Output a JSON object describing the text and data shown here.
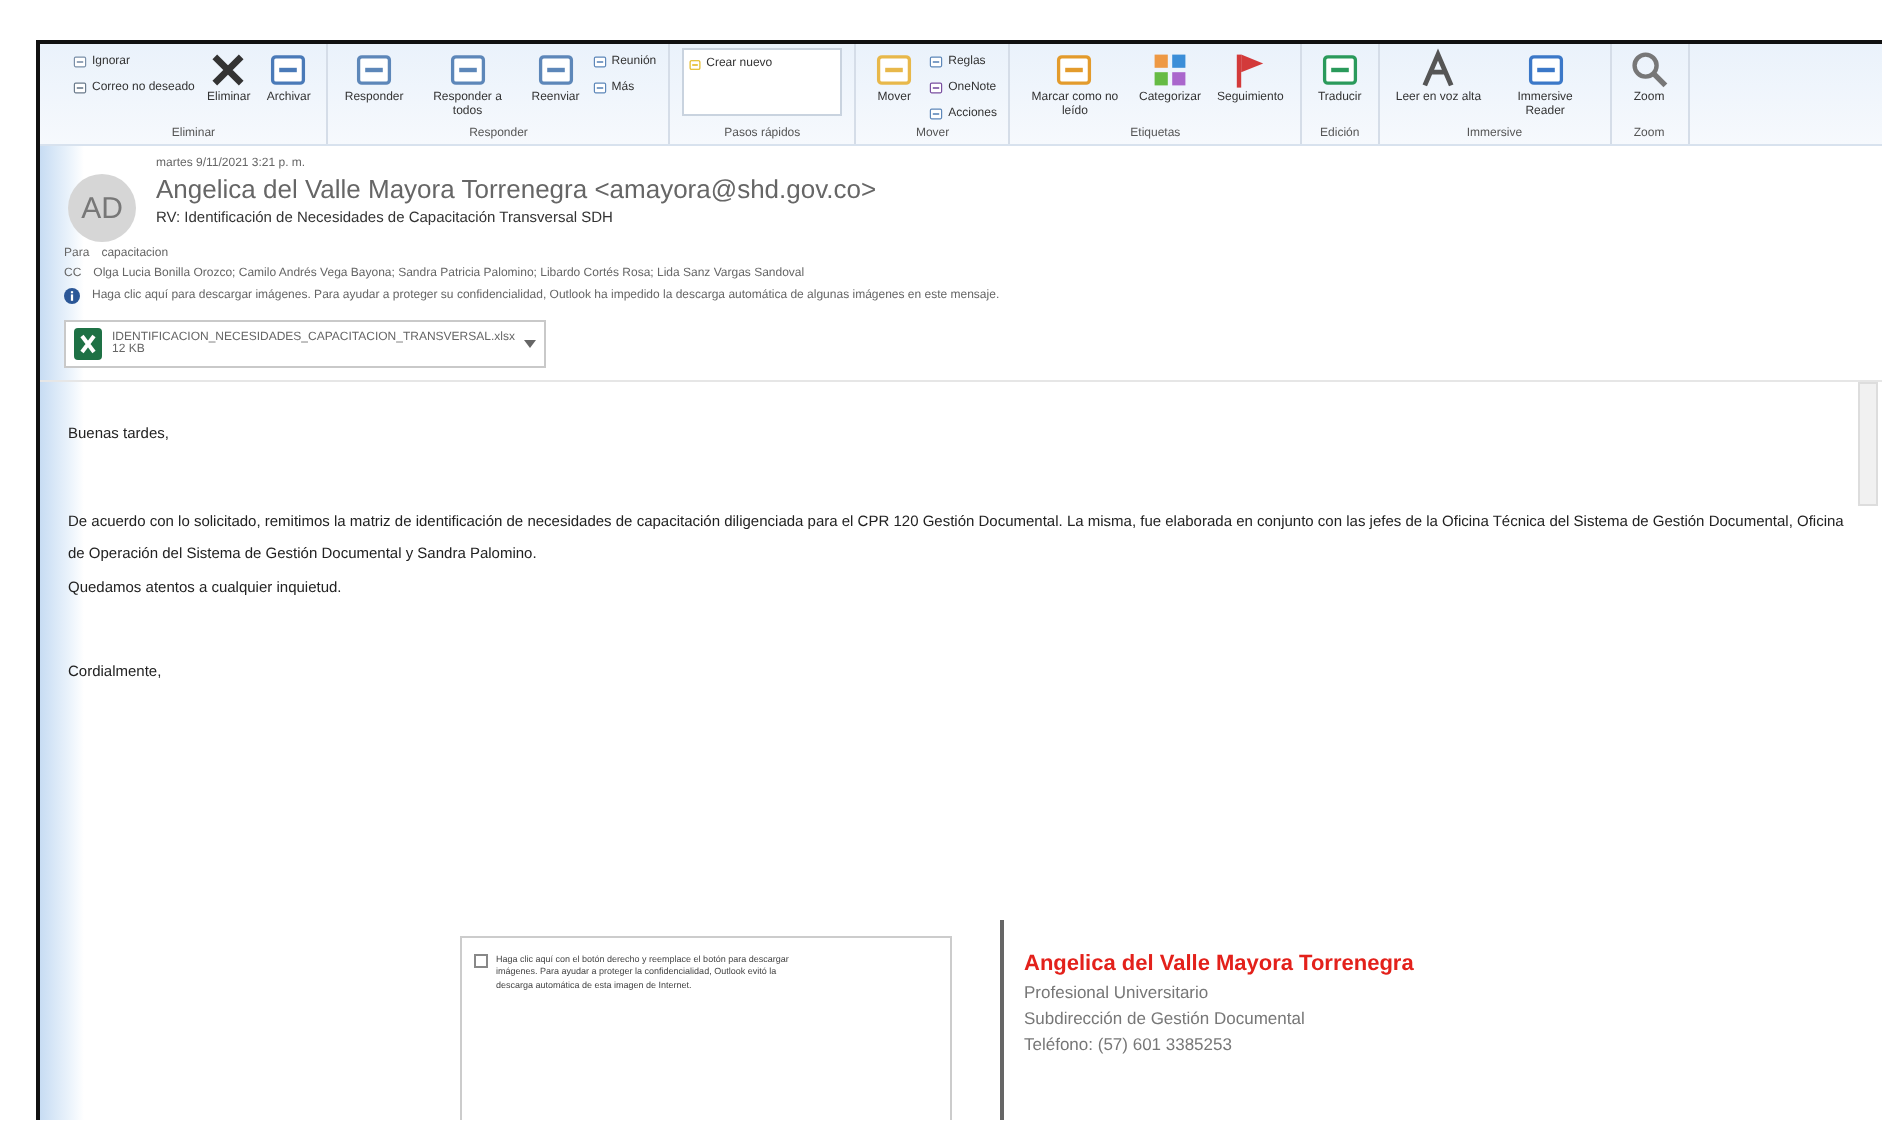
{
  "ribbon": {
    "groups": [
      {
        "label": "Eliminar",
        "buttons": [
          {
            "label": "Ignorar",
            "kind": "small"
          },
          {
            "label": "Correo no deseado",
            "kind": "small"
          },
          {
            "label": "Eliminar",
            "kind": "large"
          },
          {
            "label": "Archivar",
            "kind": "large"
          }
        ]
      },
      {
        "label": "Responder",
        "buttons": [
          {
            "label": "Responder",
            "kind": "large"
          },
          {
            "label": "Responder a todos",
            "kind": "large"
          },
          {
            "label": "Reenviar",
            "kind": "large"
          },
          {
            "label": "Reunión",
            "kind": "small"
          },
          {
            "label": "Más",
            "kind": "small"
          }
        ]
      },
      {
        "label": "Pasos rápidos",
        "buttons": [
          {
            "label": "Crear nuevo",
            "kind": "gallery"
          }
        ]
      },
      {
        "label": "Mover",
        "buttons": [
          {
            "label": "Mover",
            "kind": "large"
          },
          {
            "label": "Reglas",
            "kind": "small"
          },
          {
            "label": "OneNote",
            "kind": "small"
          },
          {
            "label": "Acciones",
            "kind": "small"
          }
        ]
      },
      {
        "label": "Etiquetas",
        "buttons": [
          {
            "label": "Marcar como no leído",
            "kind": "large"
          },
          {
            "label": "Categorizar",
            "kind": "large"
          },
          {
            "label": "Seguimiento",
            "kind": "large"
          }
        ]
      },
      {
        "label": "Edición",
        "buttons": [
          {
            "label": "Traducir",
            "kind": "large"
          }
        ]
      },
      {
        "label": "Immersive",
        "buttons": [
          {
            "label": "Leer en voz alta",
            "kind": "large"
          },
          {
            "label": "Immersive Reader",
            "kind": "large"
          }
        ]
      },
      {
        "label": "Zoom",
        "buttons": [
          {
            "label": "Zoom",
            "kind": "large"
          }
        ]
      }
    ]
  },
  "message": {
    "avatar": "AD",
    "date": "martes 9/11/2021 3:21 p. m.",
    "sender": "Angelica del Valle Mayora Torrenegra <amayora@shd.gov.co>",
    "subject": "RV: Identificación de Necesidades de Capacitación Transversal SDH",
    "to_label": "Para",
    "to": "capacitacion",
    "cc_label": "CC",
    "cc": "Olga Lucia Bonilla Orozco; Camilo Andrés Vega Bayona; Sandra Patricia Palomino; Libardo Cortés Rosa; Lida Sanz Vargas Sandoval",
    "notice": "Haga clic aquí para descargar imágenes. Para ayudar a proteger su confidencialidad, Outlook ha impedido la descarga automática de algunas imágenes en este mensaje.",
    "attachment": {
      "name": "IDENTIFICACION_NECESIDADES_CAPACITACION_TRANSVERSAL.xlsx",
      "size": "12 KB"
    }
  },
  "body": {
    "paragraphs": [
      "Buenas tardes,",
      "De acuerdo con lo solicitado, remitimos la matriz de identificación de necesidades de capacitación diligenciada para el CPR 120 Gestión Documental. La misma, fue elaborada en conjunto con las jefes de la Oficina Técnica del Sistema de Gestión Documental, Oficina de Operación del Sistema de Gestión Documental y Sandra Palomino.",
      "Quedamos atentos a cualquier inquietud.",
      "Cordialmente,"
    ],
    "image_placeholder": "Haga clic aquí con el botón derecho y reemplace el botón para descargar imágenes. Para ayudar a proteger la confidencialidad, Outlook evitó la descarga automática de esta imagen de Internet.",
    "signature": {
      "name": "Angelica del Valle Mayora Torrenegra",
      "lines": [
        "Profesional Universitario",
        "Subdirección de Gestión Documental",
        "Teléfono: (57) 601 3385253"
      ]
    }
  }
}
